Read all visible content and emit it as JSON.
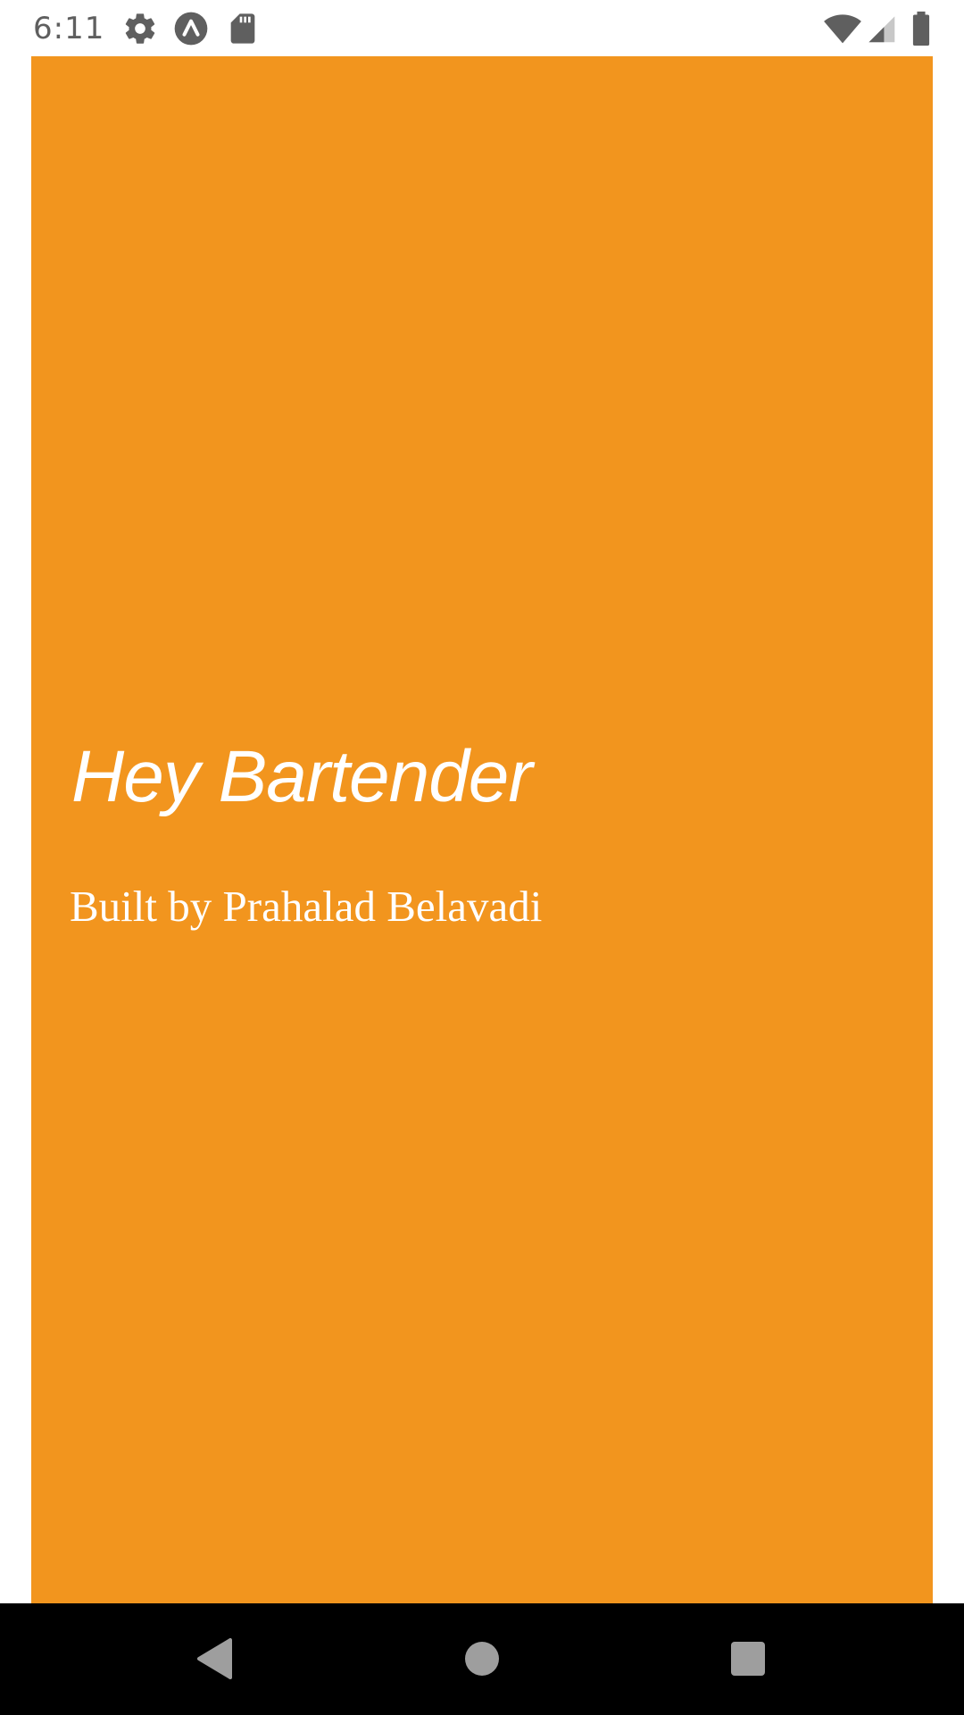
{
  "status_bar": {
    "time": "6:11",
    "icons": [
      "settings-gear-icon",
      "expo-app-icon",
      "sd-card-icon",
      "wifi-icon",
      "signal-icon",
      "battery-icon"
    ],
    "icon_color": "#5f5f5f"
  },
  "main": {
    "title": "Hey Bartender",
    "subtitle": "Built by Prahalad Belavadi",
    "background_color": "#f2951e",
    "text_color": "#ffffff"
  },
  "nav_bar": {
    "buttons": [
      "back-icon",
      "home-icon",
      "recents-icon"
    ],
    "icon_color": "#9e9e9e"
  }
}
